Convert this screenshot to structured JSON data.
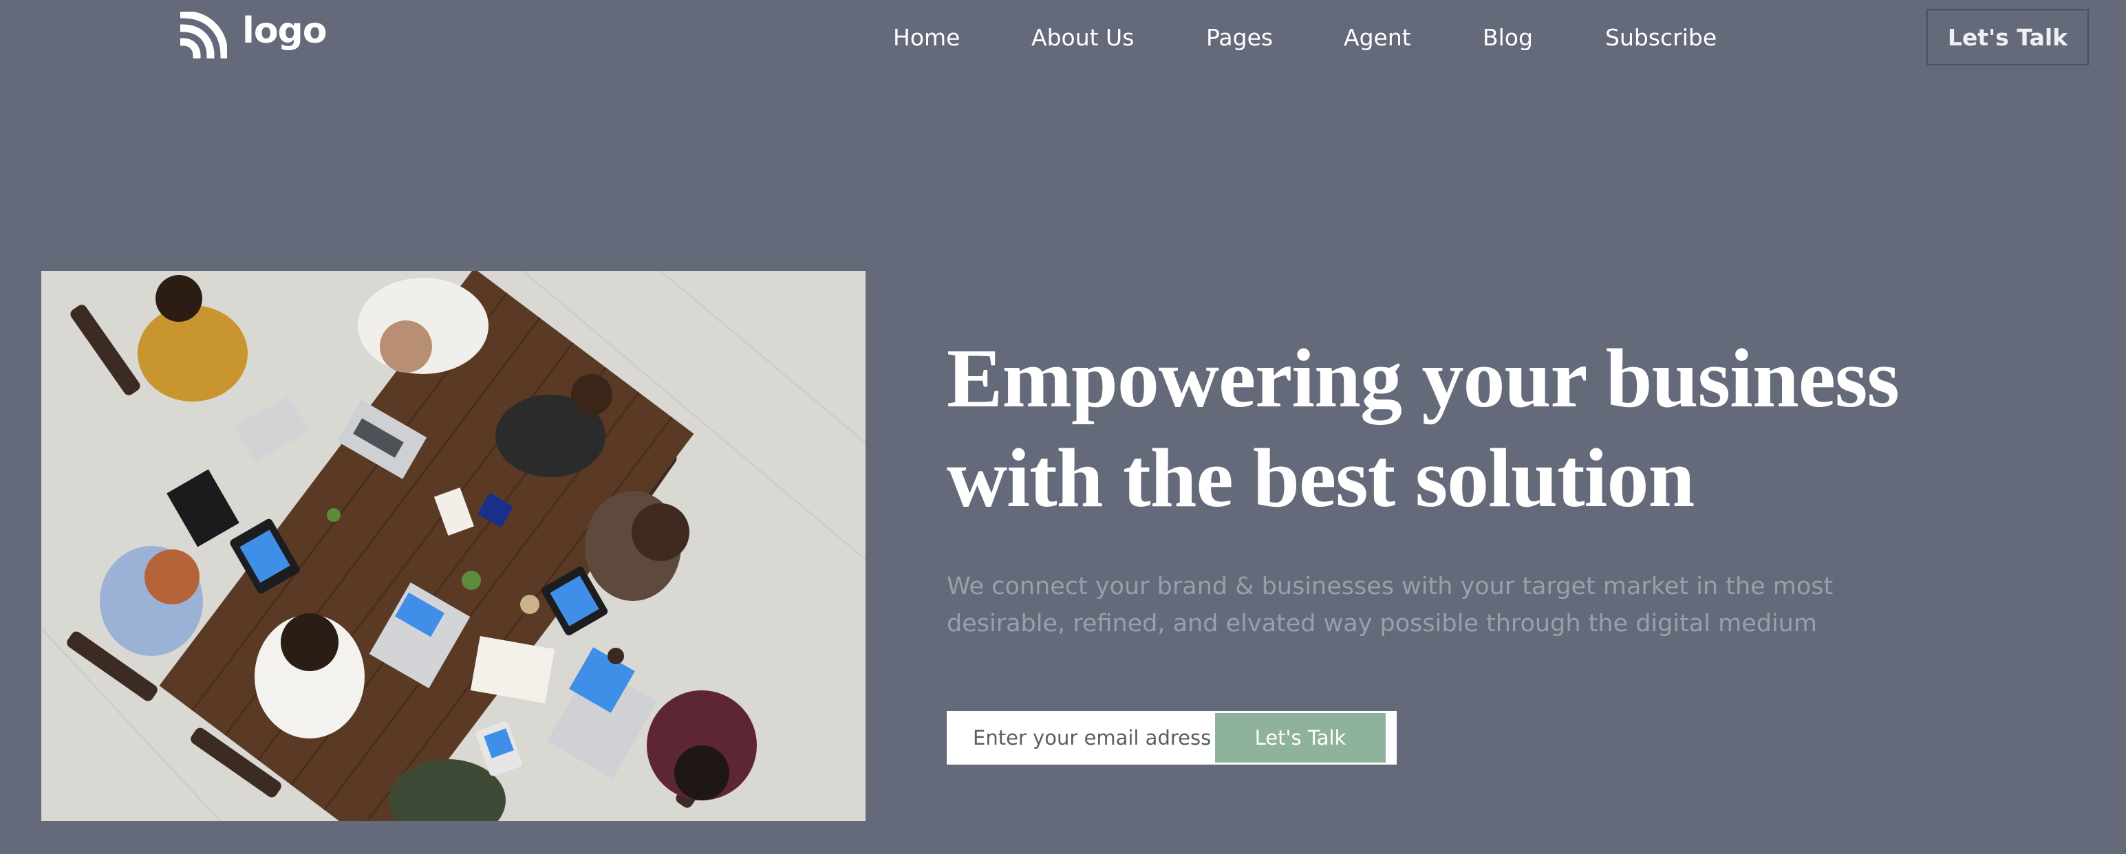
{
  "header": {
    "logo_text": "logo",
    "nav": [
      "Home",
      "About Us",
      "Pages",
      "Agent",
      "Blog",
      "Subscribe"
    ],
    "cta_label": "Let's Talk"
  },
  "hero": {
    "headline_line1": "Empowering your business",
    "headline_line2": "with the best solution",
    "subtext_line1": "We connect your brand & businesses with your target market in the most",
    "subtext_line2": "desirable, refined, and elvated way possible through the digital medium",
    "email_placeholder": "Enter your email adress",
    "button_label": "Let's Talk"
  },
  "colors": {
    "background": "#646a79",
    "accent_button": "#8fb29d",
    "subtext": "#9b9fa9"
  },
  "icons": {
    "logo": "rss-like-arcs-icon"
  }
}
